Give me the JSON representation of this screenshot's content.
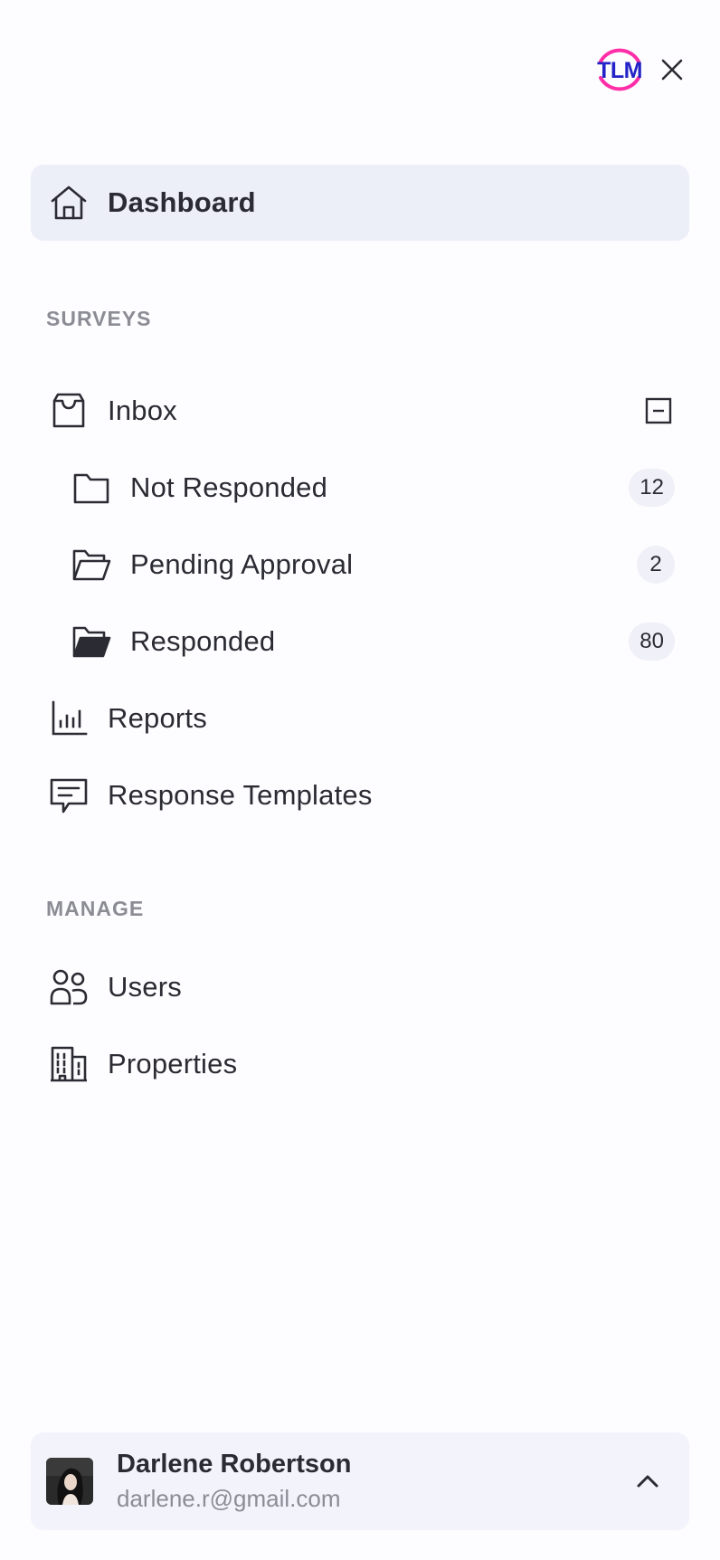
{
  "logo": {
    "text": "TLM",
    "accent_color": "#ff2ea8",
    "text_color": "#2323c8"
  },
  "close": {
    "icon": "close-icon"
  },
  "nav": {
    "dashboard": {
      "label": "Dashboard",
      "icon": "home-icon",
      "active": true
    },
    "sections": {
      "surveys": "SURVEYS",
      "manage": "MANAGE"
    },
    "inbox": {
      "label": "Inbox",
      "icon": "inbox-icon",
      "expanded": true,
      "toggle_icon": "collapse-minus-icon"
    },
    "not_responded": {
      "label": "Not Responded",
      "count": "12",
      "icon": "folder-icon"
    },
    "pending_approval": {
      "label": "Pending Approval",
      "count": "2",
      "icon": "folder-open-icon"
    },
    "responded": {
      "label": "Responded",
      "count": "80",
      "icon": "folder-filled-icon"
    },
    "reports": {
      "label": "Reports",
      "icon": "bar-chart-icon"
    },
    "response_templates": {
      "label": "Response Templates",
      "icon": "message-icon"
    },
    "users": {
      "label": "Users",
      "icon": "users-icon"
    },
    "properties": {
      "label": "Properties",
      "icon": "building-icon"
    }
  },
  "user": {
    "name": "Darlene Robertson",
    "email": "darlene.r@gmail.com",
    "menu_icon": "chevron-up-icon"
  },
  "colors": {
    "active_bg": "#eceef8",
    "badge_bg": "#eff0f8",
    "section_text": "#8c8c95",
    "text": "#2b2b33"
  }
}
